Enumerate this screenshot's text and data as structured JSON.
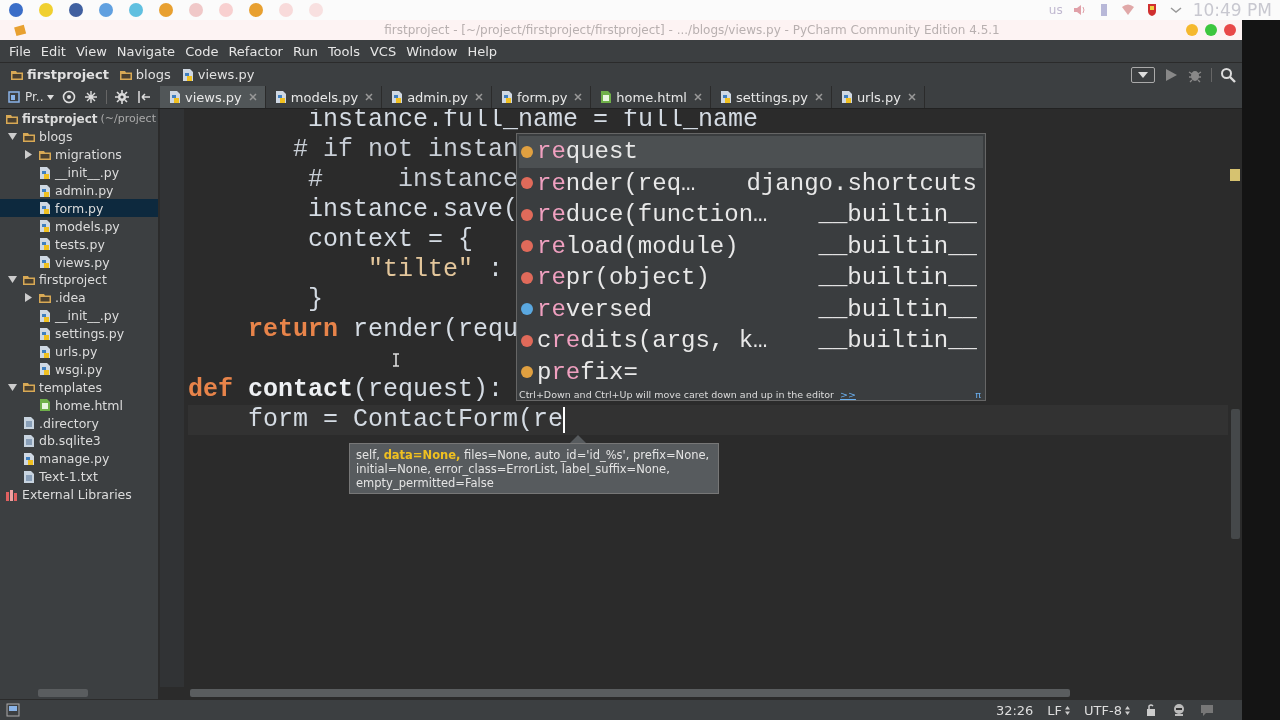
{
  "desktop_panel": {
    "keyboard_layout": "us",
    "clock": "10:49 PM"
  },
  "window": {
    "title": "firstproject - [~/project/firstproject/firstproject] - .../blogs/views.py - PyCharm Community Edition 4.5.1"
  },
  "menu": [
    "File",
    "Edit",
    "View",
    "Navigate",
    "Code",
    "Refactor",
    "Run",
    "Tools",
    "VCS",
    "Window",
    "Help"
  ],
  "breadcrumbs": [
    {
      "label": "firstproject",
      "kind": "folder"
    },
    {
      "label": "blogs",
      "kind": "folder"
    },
    {
      "label": "views.py",
      "kind": "python"
    }
  ],
  "project_view": {
    "label": "Pr.."
  },
  "tabs": [
    {
      "label": "views.py",
      "kind": "python",
      "selected": true
    },
    {
      "label": "models.py",
      "kind": "python",
      "selected": false
    },
    {
      "label": "admin.py",
      "kind": "python",
      "selected": false
    },
    {
      "label": "form.py",
      "kind": "python",
      "selected": false
    },
    {
      "label": "home.html",
      "kind": "html",
      "selected": false
    },
    {
      "label": "settings.py",
      "kind": "python",
      "selected": false
    },
    {
      "label": "urls.py",
      "kind": "python",
      "selected": false
    }
  ],
  "project_tree": [
    {
      "name": "firstproject",
      "note": "(~/project",
      "kind": "folder",
      "selected": false,
      "children": [
        {
          "name": "blogs",
          "kind": "folder",
          "expanded": true,
          "selected": false,
          "children": [
            {
              "name": "migrations",
              "kind": "folder",
              "expanded": false,
              "selected": false
            },
            {
              "name": "__init__.py",
              "kind": "python",
              "selected": false
            },
            {
              "name": "admin.py",
              "kind": "python",
              "selected": false
            },
            {
              "name": "form.py",
              "kind": "python",
              "selected": true
            },
            {
              "name": "models.py",
              "kind": "python",
              "selected": false
            },
            {
              "name": "tests.py",
              "kind": "python",
              "selected": false
            },
            {
              "name": "views.py",
              "kind": "python",
              "selected": false
            }
          ]
        },
        {
          "name": "firstproject",
          "kind": "folder",
          "expanded": true,
          "selected": false,
          "children": [
            {
              "name": ".idea",
              "kind": "folder",
              "expanded": false,
              "selected": false
            },
            {
              "name": "__init__.py",
              "kind": "python",
              "selected": false
            },
            {
              "name": "settings.py",
              "kind": "python",
              "selected": false
            },
            {
              "name": "urls.py",
              "kind": "python",
              "selected": false
            },
            {
              "name": "wsgi.py",
              "kind": "python",
              "selected": false
            }
          ]
        },
        {
          "name": "templates",
          "kind": "folder",
          "expanded": true,
          "selected": false,
          "children": [
            {
              "name": "home.html",
              "kind": "html",
              "selected": false
            }
          ]
        },
        {
          "name": ".directory",
          "kind": "text",
          "selected": false
        },
        {
          "name": "db.sqlite3",
          "kind": "text",
          "selected": false
        },
        {
          "name": "manage.py",
          "kind": "python",
          "selected": false
        },
        {
          "name": "Text-1.txt",
          "kind": "text",
          "selected": false
        }
      ]
    },
    {
      "name": "External Libraries",
      "kind": "library",
      "selected": false
    }
  ],
  "code_lines": [
    [
      {
        "kind": "plain",
        "text": "        instance.full_name = full_name"
      }
    ],
    [
      {
        "kind": "comment",
        "text": "       # if not instan"
      }
    ],
    [
      {
        "kind": "comment",
        "text": "        #     instance"
      }
    ],
    [
      {
        "kind": "plain",
        "text": "        instance.save("
      }
    ],
    [
      {
        "kind": "plain",
        "text": "        context = {"
      }
    ],
    [
      {
        "kind": "string",
        "text": "            \"tilte\""
      },
      {
        "kind": "plain",
        "text": " :"
      }
    ],
    [
      {
        "kind": "plain",
        "text": "        }"
      }
    ],
    [
      {
        "kind": "keyword",
        "text": "    return"
      },
      {
        "kind": "plain",
        "text": " render(requ"
      }
    ],
    [
      {
        "kind": "pointer"
      }
    ],
    [
      {
        "kind": "keyword",
        "text": "def"
      },
      {
        "kind": "name",
        "text": " contact"
      },
      {
        "kind": "plain",
        "text": "(request):"
      }
    ],
    [
      {
        "kind": "plain",
        "text": "    form = ContactForm(re"
      },
      {
        "kind": "caret"
      }
    ]
  ],
  "completion": {
    "items": [
      {
        "name": "**re**quest",
        "color": "#e0a040",
        "selected": true
      },
      {
        "name": "**re**nder(req…",
        "source": "django.shortcuts",
        "color": "#e06a5a",
        "selected": false
      },
      {
        "name": "**re**duce(function…",
        "source": "__builtin__",
        "color": "#e06a5a",
        "selected": false
      },
      {
        "name": "**re**load(module)",
        "source": "__builtin__",
        "color": "#e06a5a",
        "selected": false
      },
      {
        "name": "**re**pr(object)",
        "source": "__builtin__",
        "color": "#e06a5a",
        "selected": false
      },
      {
        "name": "**re**versed",
        "source": "__builtin__",
        "color": "#5aa8e0",
        "selected": false
      },
      {
        "name": "c**re**dits(args, k…",
        "source": "__builtin__",
        "color": "#e06a5a",
        "selected": false
      },
      {
        "name": "p**re**fix=",
        "color": "#e0a040",
        "selected": false
      }
    ],
    "hint": "Ctrl+Down and Ctrl+Up will move caret down and up in the editor",
    "hint_link": ">>",
    "pin": "π"
  },
  "parameter_info": "self, **data=None,** files=None, auto_id='id_%s', prefix=None, initial=None, error_class=ErrorList, label_suffix=None, empty_permitted=False",
  "status_bar": {
    "position": "32:26",
    "line_separator": "LF",
    "encoding": "UTF-8"
  }
}
